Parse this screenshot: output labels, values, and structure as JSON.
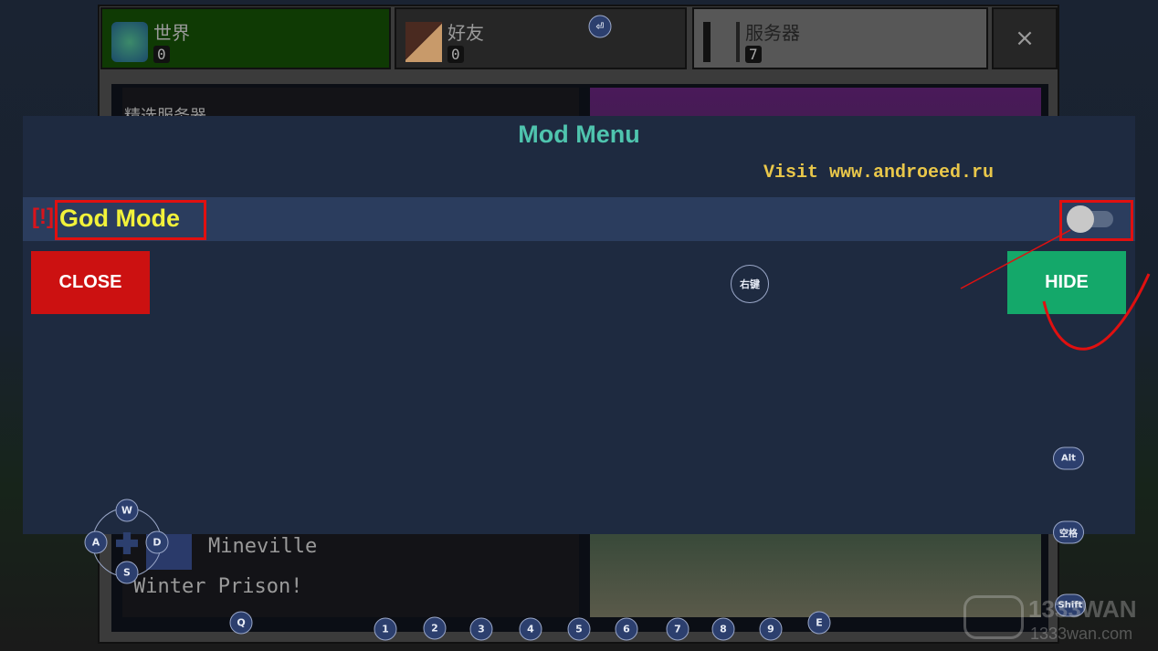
{
  "tabs": [
    {
      "label": "世界",
      "count": "0",
      "icon": "globe-icon",
      "active": true
    },
    {
      "label": "好友",
      "count": "0",
      "icon": "friends-icon"
    },
    {
      "label": "服务器",
      "count": "7",
      "icon": "server-icon"
    }
  ],
  "tab_close": "×",
  "background": {
    "featured": "精选服务器",
    "server_name": "Mineville",
    "server_desc": "Winter Prison!"
  },
  "mod_menu": {
    "title": "Mod Menu",
    "visit": "Visit www.androeed.ru",
    "warn": "[!]",
    "feature": "God Mode",
    "toggle_on": false,
    "close": "CLOSE",
    "hide": "HIDE"
  },
  "keys": {
    "enter": "⏎",
    "right_click": "右键",
    "w": "W",
    "a": "A",
    "s": "S",
    "d": "D",
    "q": "Q",
    "e": "E",
    "n1": "1",
    "n2": "2",
    "n3": "3",
    "n4": "4",
    "n5": "5",
    "n6": "6",
    "n7": "7",
    "n8": "8",
    "n9": "9",
    "alt": "Alt",
    "space": "空格",
    "shift": "Shift"
  },
  "watermark": {
    "brand": "1333WAN",
    "site": "1333wan.com"
  },
  "colors": {
    "close": "#cc1111",
    "hide": "#14a86a",
    "title": "#4fc4ae",
    "feature": "#f2f23a",
    "annotation": "#e01010"
  }
}
